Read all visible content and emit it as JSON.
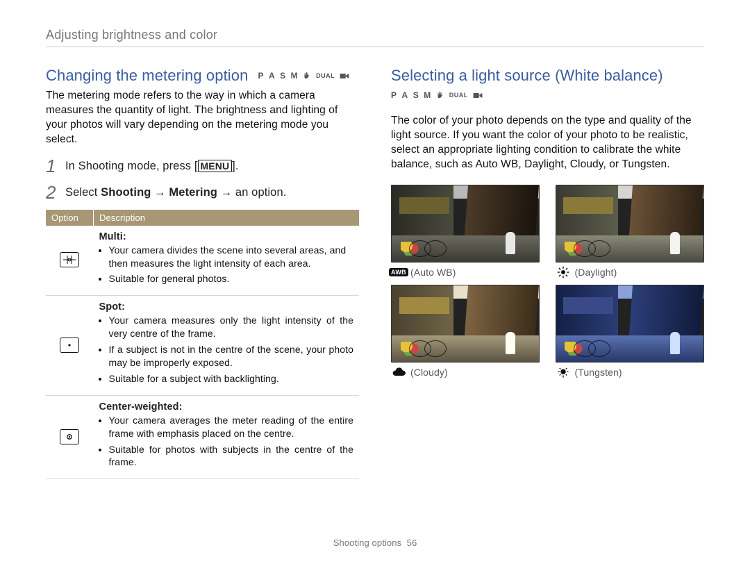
{
  "header": {
    "section_path": "Adjusting brightness and color"
  },
  "mode_labels": {
    "p": "P",
    "a": "A",
    "s": "S",
    "m": "M",
    "dual": "DUAL"
  },
  "left": {
    "title": "Changing the metering option",
    "intro": "The metering mode refers to the way in which a camera measures the quantity of light. The brightness and lighting of your photos will vary depending on the metering mode you select.",
    "step1_prefix": "In Shooting mode, press [",
    "step1_button": "MENU",
    "step1_suffix": "].",
    "step2_prefix": "Select ",
    "step2_b1": "Shooting",
    "step2_arrow": " → ",
    "step2_b2": "Metering",
    "step2_suffix": " → an option.",
    "table": {
      "head_option": "Option",
      "head_desc": "Description",
      "rows": [
        {
          "icon": "multi",
          "title": "Multi:",
          "bullets": [
            "Your camera divides the scene into several areas, and then measures the light intensity of each area.",
            "Suitable for general photos."
          ]
        },
        {
          "icon": "spot",
          "title": "Spot:",
          "bullets": [
            "Your camera measures only the light intensity of the very centre of the frame.",
            "If a subject is not in the centre of the scene, your photo may be improperly exposed.",
            "Suitable for a subject with backlighting."
          ]
        },
        {
          "icon": "center",
          "title": "Center-weighted:",
          "bullets": [
            "Your camera averages the meter reading of the entire frame with emphasis placed on the centre.",
            "Suitable for photos with subjects in the centre of the frame."
          ]
        }
      ]
    }
  },
  "right": {
    "title": "Selecting a light source (White balance)",
    "intro": "The color of your photo depends on the type and quality of the light source. If you want the color of your photo to be realistic, select an appropriate lighting condition to calibrate the white balance, such as Auto WB, Daylight, Cloudy, or Tungsten.",
    "thumbs": [
      {
        "key": "auto",
        "label": "Auto WB",
        "icon": "awb"
      },
      {
        "key": "daylight",
        "label": "Daylight",
        "icon": "sun"
      },
      {
        "key": "cloudy",
        "label": "Cloudy",
        "icon": "cloud"
      },
      {
        "key": "tungsten",
        "label": "Tungsten",
        "icon": "bulb"
      }
    ]
  },
  "footer": {
    "label": "Shooting options",
    "page": "56"
  }
}
